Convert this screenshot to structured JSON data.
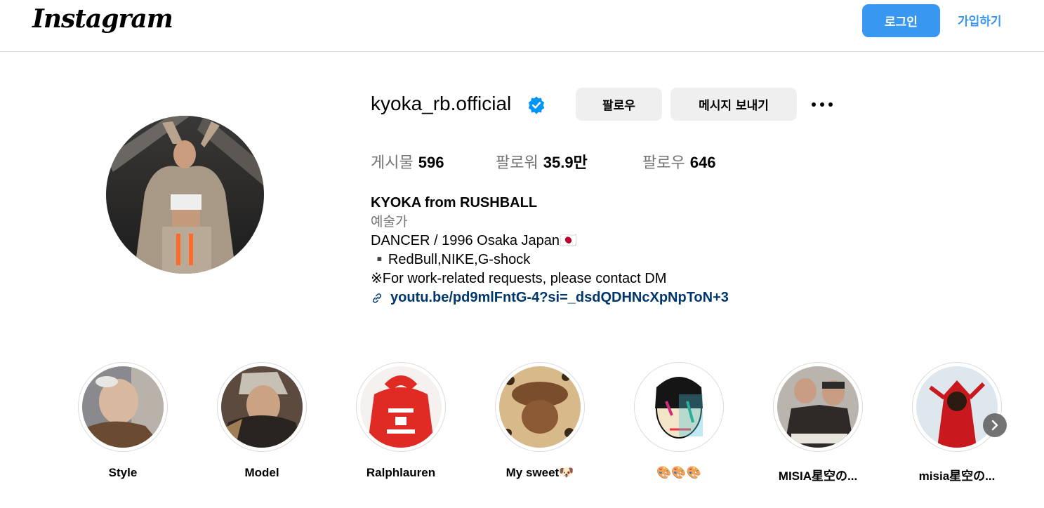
{
  "nav": {
    "logo": "Instagram",
    "login_label": "로그인",
    "signup_label": "가입하기",
    "accent": "#3897f0"
  },
  "profile": {
    "username": "kyoka_rb.official",
    "verified_icon": "verified-badge-icon",
    "follow_label": "팔로우",
    "message_label": "메시지 보내기",
    "more_icon": "more-options-icon"
  },
  "stats": {
    "posts_label": "게시물",
    "posts_value": "596",
    "followers_label": "팔로워",
    "followers_value": "35.9만",
    "following_label": "팔로우",
    "following_value": "646"
  },
  "bio": {
    "name": "KYOKA from RUSHBALL",
    "category": "예술가",
    "lines": [
      "DANCER / 1996 Osaka Japan🇯🇵",
      "▪️RedBull,NIKE,G-shock",
      "※For work-related requests, please contact DM"
    ],
    "link": "youtu.be/pd9mlFntG-4?si=_dsdQDHNcXpNpToN+3",
    "link_icon": "link-icon"
  },
  "highlights": [
    {
      "label": "Style"
    },
    {
      "label": "Model"
    },
    {
      "label": "Ralphlauren"
    },
    {
      "label": "My sweet🐶"
    },
    {
      "label": "🎨🎨🎨"
    },
    {
      "label": "MISIA星空の..."
    },
    {
      "label": "misia星空の..."
    }
  ],
  "highlight_next_icon": "chevron-right-icon"
}
